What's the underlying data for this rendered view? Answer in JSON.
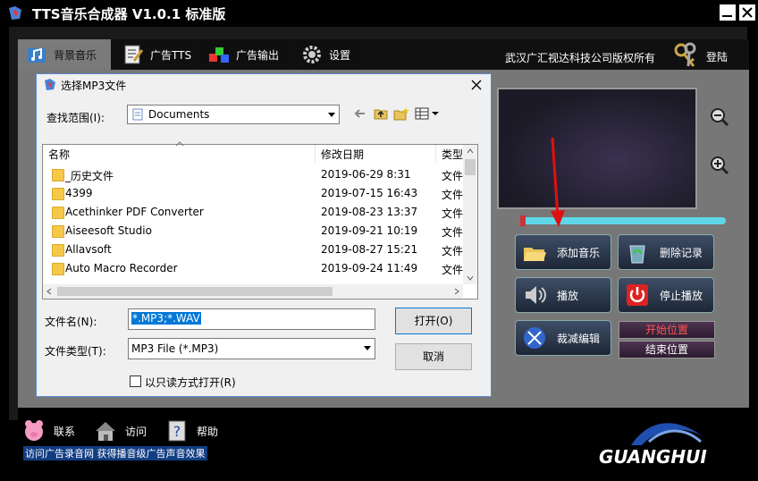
{
  "app": {
    "title": "TTS音乐合成器  V1.0.1 标准版",
    "copyright": "武汉广汇视达科技公司版权所有",
    "login": "登陆",
    "tabs": [
      {
        "label": "背景音乐",
        "icon": "music-note-icon",
        "active": true
      },
      {
        "label": "广告TTS",
        "icon": "document-pencil-icon"
      },
      {
        "label": "广告输出",
        "icon": "output-cubes-icon"
      },
      {
        "label": "设置",
        "icon": "gear-icon"
      }
    ],
    "actions": {
      "add_music": "添加音乐",
      "delete_record": "删除记录",
      "play": "播放",
      "stop_play": "停止播放",
      "cut_edit": "裁减编辑",
      "start_position": "开始位置",
      "end_position": "结束位置"
    },
    "bottom": {
      "contact": "联系",
      "visit": "访问",
      "help": "帮助",
      "strip": "访问广告录音网  获得播音级广告声音效果",
      "logo_text": "GUANGHUI"
    },
    "colors": {
      "progress": "#5fd7e8",
      "accent_red": "#cc3333",
      "stripe_blue": "#123d82"
    }
  },
  "dialog": {
    "title": "选择MP3文件",
    "look_in_label": "查找范围(I):",
    "look_in_value": "Documents",
    "columns": {
      "name": "名称",
      "modified": "修改日期",
      "type": "类型"
    },
    "files": [
      {
        "name": "_历史文件",
        "date": "2019-06-29 8:31",
        "type": "文件"
      },
      {
        "name": "4399",
        "date": "2019-07-15 16:43",
        "type": "文件"
      },
      {
        "name": "Acethinker PDF Converter",
        "date": "2019-08-23 13:37",
        "type": "文件"
      },
      {
        "name": "Aiseesoft Studio",
        "date": "2019-09-21 10:19",
        "type": "文件"
      },
      {
        "name": "Allavsoft",
        "date": "2019-08-27 15:21",
        "type": "文件"
      },
      {
        "name": "Auto Macro Recorder",
        "date": "2019-09-24 11:49",
        "type": "文件"
      }
    ],
    "filename_label": "文件名(N):",
    "filename_value": "*.MP3;*.WAV",
    "filetype_label": "文件类型(T):",
    "filetype_value": "MP3 File (*.MP3)",
    "open_button": "打开(O)",
    "cancel_button": "取消",
    "readonly_label": "以只读方式打开(R)"
  }
}
